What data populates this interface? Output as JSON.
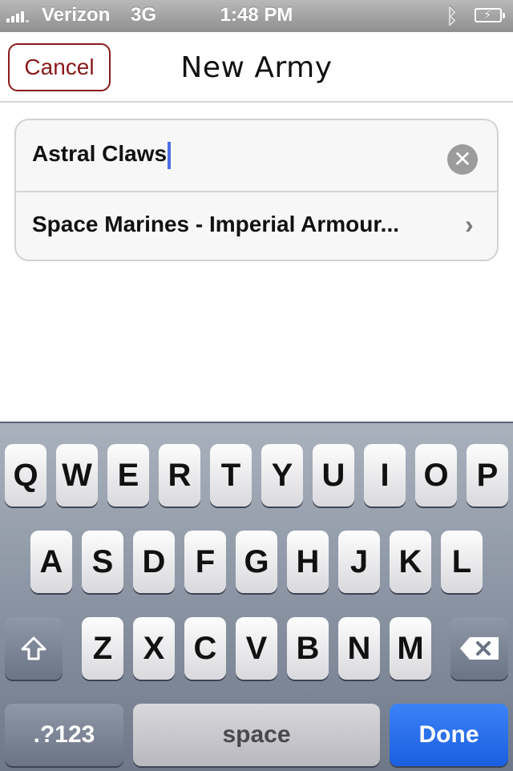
{
  "status_bar": {
    "carrier": "Verizon",
    "network": "3G",
    "time": "1:48 PM"
  },
  "nav": {
    "cancel_label": "Cancel",
    "title": "New Army"
  },
  "form": {
    "army_name_value": "Astral Claws",
    "army_type_value": "Space Marines - Imperial Armour..."
  },
  "keyboard": {
    "row1": [
      "Q",
      "W",
      "E",
      "R",
      "T",
      "Y",
      "U",
      "I",
      "O",
      "P"
    ],
    "row2": [
      "A",
      "S",
      "D",
      "F",
      "G",
      "H",
      "J",
      "K",
      "L"
    ],
    "row3": [
      "Z",
      "X",
      "C",
      "V",
      "B",
      "N",
      "M"
    ],
    "numbers_label": ".?123",
    "space_label": "space",
    "done_label": "Done"
  },
  "colors": {
    "cancel_accent": "#8b1a1a",
    "done_blue": "#2a6df0",
    "caret_blue": "#4b6ee8"
  }
}
